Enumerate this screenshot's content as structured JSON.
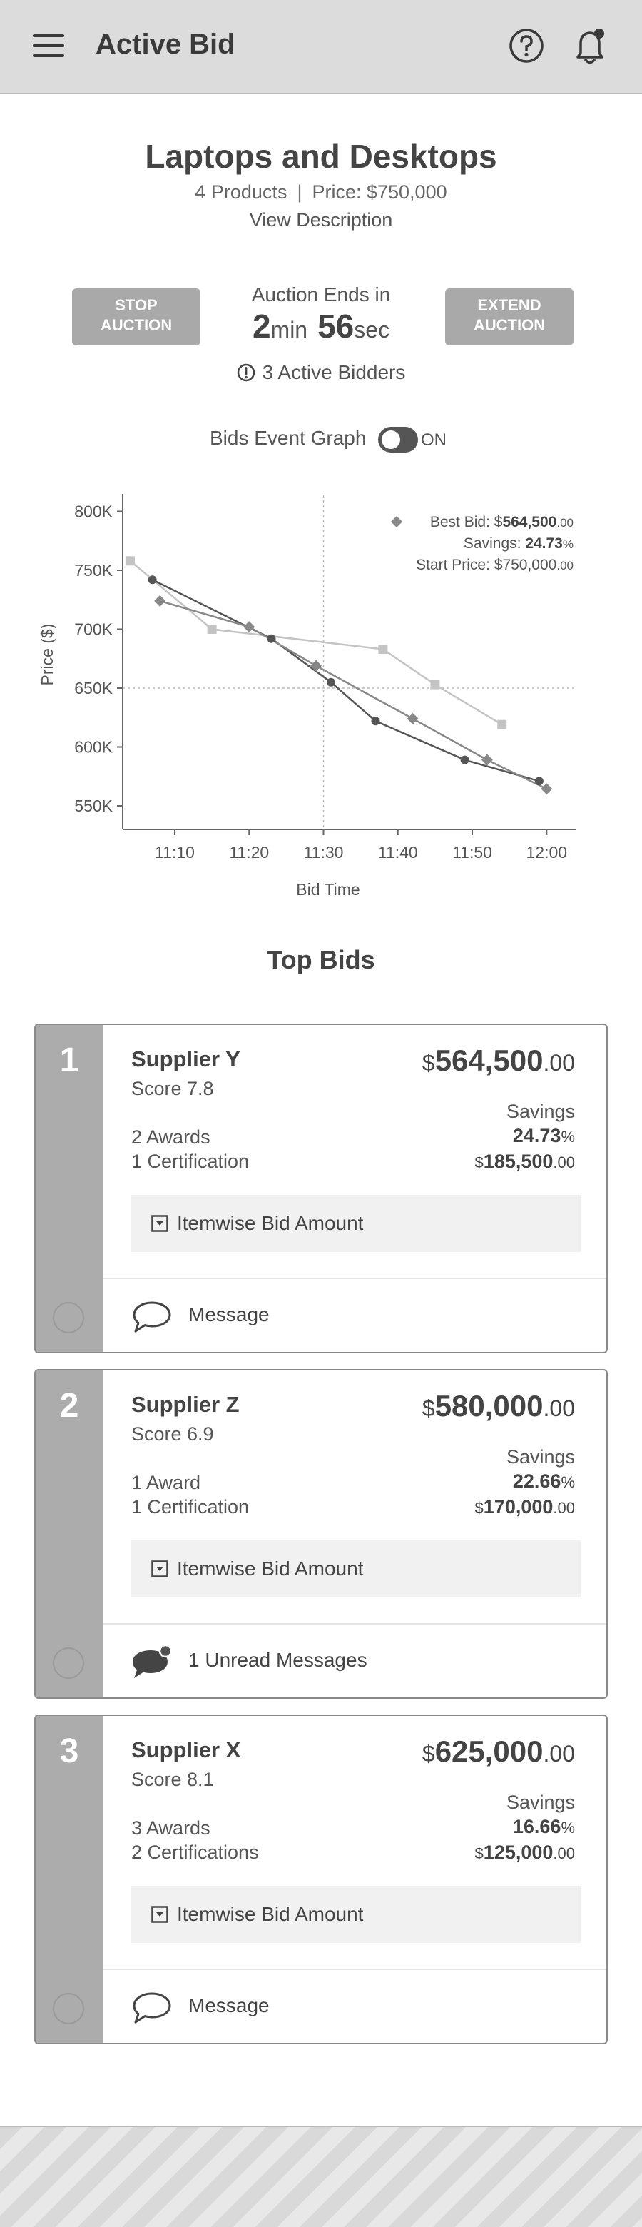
{
  "header": {
    "title": "Active Bid"
  },
  "auction": {
    "title": "Laptops and Desktops",
    "products": "4 Products",
    "price": "Price: $750,000",
    "view_description": "View Description",
    "stop_label_1": "STOP",
    "stop_label_2": "AUCTION",
    "extend_label_1": "EXTEND",
    "extend_label_2": "AUCTION",
    "ends_label": "Auction Ends in",
    "minutes": "2",
    "minutes_unit": "min",
    "seconds": "56",
    "seconds_unit": "sec",
    "active_bidders": "3 Active Bidders"
  },
  "graph": {
    "label": "Bids Event Graph",
    "toggle_state": "ON"
  },
  "chart_data": {
    "type": "line",
    "xlabel": "Bid Time",
    "ylabel": "Price ($)",
    "x_ticks": [
      "11:10",
      "11:20",
      "11:30",
      "11:40",
      "11:50",
      "12:00"
    ],
    "y_ticks": [
      "800K",
      "750K",
      "700K",
      "650K",
      "600K",
      "550K"
    ],
    "ylim": [
      530000,
      810000
    ],
    "xlim": [
      "11:03",
      "12:04"
    ],
    "annotation": {
      "best_bid_label": "Best Bid: $",
      "best_bid_int": "564,500",
      "best_bid_dec": ".00",
      "savings_label": "Savings: ",
      "savings_value": "24.73",
      "savings_unit": "%",
      "start_price_label": "Start Price: $750,000",
      "start_price_dec": ".00"
    },
    "reference_time": "11:30",
    "reference_price": 650000,
    "series": [
      {
        "marker": "square",
        "color": "#c4c4c4",
        "points": [
          [
            "11:04",
            758000
          ],
          [
            "11:15",
            700000
          ],
          [
            "11:38",
            683000
          ],
          [
            "11:45",
            653000
          ],
          [
            "11:54",
            619000
          ]
        ]
      },
      {
        "marker": "circle",
        "color": "#555555",
        "points": [
          [
            "11:07",
            742000
          ],
          [
            "11:23",
            692000
          ],
          [
            "11:31",
            655000
          ],
          [
            "11:37",
            622000
          ],
          [
            "11:49",
            589000
          ],
          [
            "11:59",
            571000
          ]
        ]
      },
      {
        "marker": "diamond",
        "color": "#888888",
        "points": [
          [
            "11:08",
            724000
          ],
          [
            "11:20",
            702000
          ],
          [
            "11:29",
            669000
          ],
          [
            "11:42",
            624000
          ],
          [
            "11:52",
            589000
          ],
          [
            "12:00",
            564500
          ]
        ]
      }
    ]
  },
  "top_bids": {
    "title": "Top Bids",
    "savings_label": "Savings",
    "itemwise_label": "Itemwise Bid Amount",
    "bids": [
      {
        "rank": "1",
        "supplier": "Supplier Y",
        "score": "Score 7.8",
        "awards": "2 Awards",
        "certifications": "1 Certification",
        "currency": "$",
        "amount": "564,500",
        "amount_dec": ".00",
        "savings_pct": "24.73",
        "pct_unit": "%",
        "savings_cur": "$",
        "savings_amt": "185,500",
        "savings_dec": ".00",
        "message": "Message"
      },
      {
        "rank": "2",
        "supplier": "Supplier Z",
        "score": "Score 6.9",
        "awards": "1 Award",
        "certifications": "1 Certification",
        "currency": "$",
        "amount": "580,000",
        "amount_dec": ".00",
        "savings_pct": "22.66",
        "pct_unit": "%",
        "savings_cur": "$",
        "savings_amt": "170,000",
        "savings_dec": ".00",
        "message": "1 Unread Messages"
      },
      {
        "rank": "3",
        "supplier": "Supplier X",
        "score": "Score 8.1",
        "awards": "3 Awards",
        "certifications": "2 Certifications",
        "currency": "$",
        "amount": "625,000",
        "amount_dec": ".00",
        "savings_pct": "16.66",
        "pct_unit": "%",
        "savings_cur": "$",
        "savings_amt": "125,000",
        "savings_dec": ".00",
        "message": "Message"
      }
    ]
  }
}
